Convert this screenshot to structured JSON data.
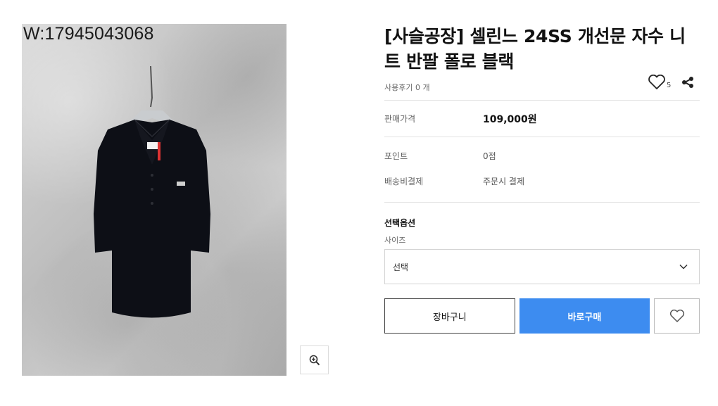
{
  "product": {
    "watermark": "W:17945043068",
    "title": "[사슬공장] 셀린느 24SS 개선문 자수 니트 반팔 폴로 블랙",
    "review_text": "사용후기 0 개",
    "like_count": "5"
  },
  "details": {
    "price_label": "판매가격",
    "price_value": "109,000원",
    "points_label": "포인트",
    "points_value": "0점",
    "shipping_label": "배송비결제",
    "shipping_value": "주문시 결제"
  },
  "options": {
    "title": "선택옵션",
    "size_label": "사이즈",
    "size_selected": "선택"
  },
  "actions": {
    "cart_label": "장바구니",
    "buy_label": "바로구매"
  },
  "icons": {
    "zoom": "zoom-in-icon",
    "like": "heart-icon",
    "share": "share-icon",
    "dropdown": "chevron-down-icon",
    "wish": "heart-icon"
  },
  "colors": {
    "buy_button": "#3d8cf0",
    "garment": "#0d0f16"
  }
}
